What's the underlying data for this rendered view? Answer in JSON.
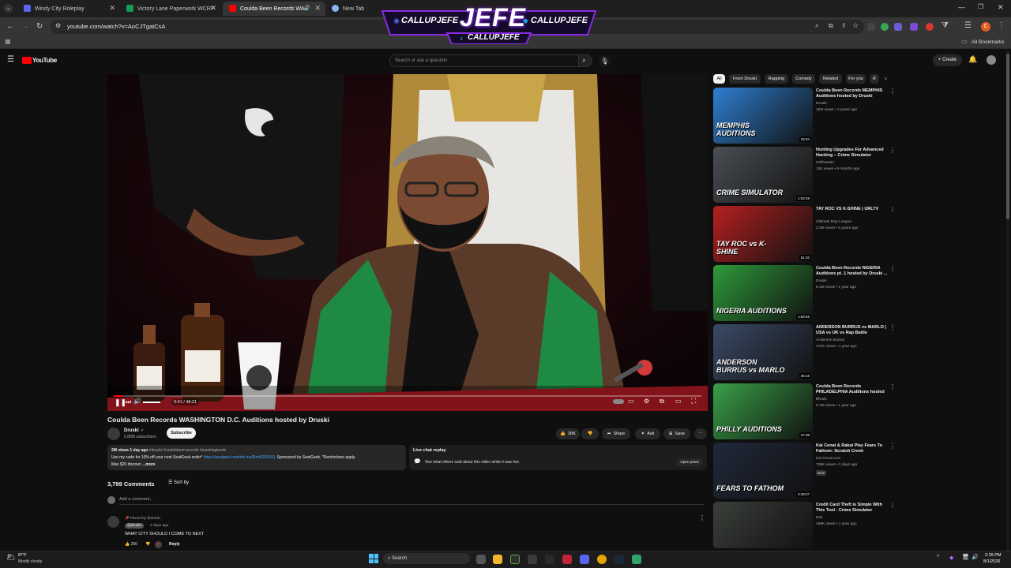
{
  "browser": {
    "tabs": [
      {
        "title": "Windy City Roleplay",
        "favcolor": "#5865f2"
      },
      {
        "title": "Victory Lane Paperwork WCRP",
        "favcolor": "#0f9d58"
      },
      {
        "title": "Coulda Been Records WAS",
        "favcolor": "#ff0000"
      },
      {
        "title": "New Tab",
        "favcolor": "#8ab4f8"
      }
    ],
    "url": "youtube.com/watch?v=AoCJTgatCsA",
    "all_bookmarks": "All Bookmarks"
  },
  "overlay": {
    "logo": "JEFE",
    "handle1": "CALLUPJEFE",
    "handle2": "CALLUPJEFE",
    "handle3": "CALLUPJEFE"
  },
  "youtube": {
    "logo": "YouTube",
    "search_placeholder": "Search or ask a question",
    "create_label": "Create"
  },
  "player": {
    "time": "0:41 / 48:21",
    "progress": 0.0142
  },
  "video": {
    "title": "Coulda Been Records WASHINGTON D.C. Auditions hosted by Druski",
    "channel": "Druski",
    "subscribers": "5.88M subscribers",
    "subscribe_label": "Subscribe",
    "likes": "30K",
    "share_label": "Share",
    "ask_label": "Ask",
    "save_label": "Save",
    "desc_line1_views": "2M views  1 day ago",
    "desc_line1_tags": "#druski #couldabeenrecords #washingtondc",
    "desc_line2_pre": "Use my code for 10% off your next SeatGeek order*",
    "desc_line2_link": "https://seatgeek.onelink.me/RmK/DRUSL",
    "desc_line2_post": "Sponsored by SeatGeek. *Restrictions apply.",
    "desc_line3": "Max $20 discoun",
    "more": "...more"
  },
  "live_chat": {
    "title": "Live chat replay",
    "subtitle": "See what others said about this video while it was live.",
    "open_panel": "Open panel"
  },
  "comments": {
    "count": "3,799 Comments",
    "sort_label": "Sort by",
    "add_placeholder": "Add a comment...",
    "pinned_label": "Pinned by @druski",
    "author": "@druski",
    "time": "2 days ago",
    "text": "WHAT CITY SHOULD I COME TO NEXT",
    "likes": "256",
    "reply_label": "Reply"
  },
  "chips": [
    {
      "label": "All",
      "active": true
    },
    {
      "label": "From Druski",
      "active": false
    },
    {
      "label": "Rapping",
      "active": false
    },
    {
      "label": "Comedy",
      "active": false
    },
    {
      "label": "Related",
      "active": false
    },
    {
      "label": "For you",
      "active": false
    },
    {
      "label": "R",
      "active": false
    }
  ],
  "recommendations": [
    {
      "title": "Coulda Been Records MEMPHIS Auditions hosted by Druski",
      "channel": "Druski",
      "meta": "15M views • 2 years ago",
      "duration": "33:34",
      "thumb_text": "MEMPHIS AUDITIONS",
      "thumb_color": "#2e7fd1"
    },
    {
      "title": "Hunting Upgrades For Advanced Hacking – Crime Simulator",
      "channel": "Grillmaster",
      "meta": "13K views • 9 months ago",
      "duration": "1:02:29",
      "thumb_text": "CRIME SIMULATOR",
      "thumb_color": "#4a4f55"
    },
    {
      "title": "TAY ROC VS K-SHINE | URLTV",
      "channel": "Ultimate Rap League",
      "meta": "3.3M views • 6 years ago",
      "duration": "51:33",
      "thumb_text": "TAY ROC vs K-SHINE",
      "thumb_color": "#b52020"
    },
    {
      "title": "Coulda Been Records NIGERIA Auditions pt. 1 hosted by Druski ...",
      "channel": "Druski",
      "meta": "8.1M views • 1 year ago",
      "duration": "1:00:46",
      "thumb_text": "NIGERIA AUDITIONS",
      "thumb_color": "#2e9a3a"
    },
    {
      "title": "ANDERSON BURRUS vs MARLO | USA vs UK vs Rap Battle",
      "channel": "Anderson Burrus",
      "meta": "171K views • 1 year ago",
      "duration": "35:16",
      "thumb_text": "ANDERSON BURRUS vs MARLO",
      "thumb_color": "#3a4a66"
    },
    {
      "title": "Coulda Been Records PHILADELPHIA Auditions hosted ...",
      "channel": "Druski",
      "meta": "8.7M views • 1 year ago",
      "duration": "37:38",
      "thumb_text": "PHILLY AUDITIONS",
      "thumb_color": "#3aa048"
    },
    {
      "title": "Kai Cenat & Rakai Play Fears To Fathom: Scratch Creek",
      "channel": "Kai Cenat Live",
      "meta": "728K views • 2 days ago",
      "duration": "3:48:27",
      "badge": "New",
      "thumb_text": "FEARS TO FATHOM",
      "thumb_color": "#20283a"
    },
    {
      "title": "Credit Card Theft is Simple With This Tool - Crime Simulator",
      "channel": "Dnit",
      "meta": "189K views • 1 year ago",
      "duration": "",
      "thumb_text": "",
      "thumb_color": "#3b3f3a"
    }
  ],
  "taskbar": {
    "weather_temp": "87°F",
    "weather_desc": "Mostly cloudy",
    "search_label": "Search",
    "time": "2:29 PM",
    "date": "8/1/2026"
  },
  "colors": {
    "yt_red": "#ff0000",
    "accent_blue": "#3ea6ff",
    "jersey_green": "#1f8a43"
  }
}
